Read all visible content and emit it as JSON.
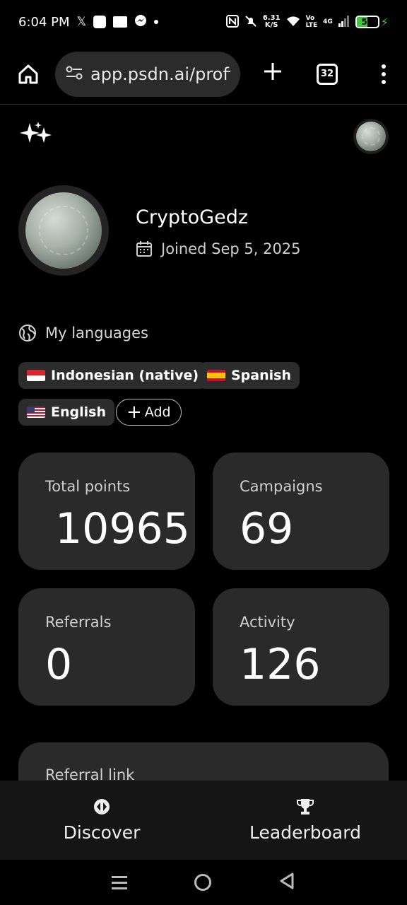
{
  "status_bar": {
    "time": "6:04 PM",
    "network_speed_value": "6.31",
    "network_speed_unit": "K/S",
    "volte": "Vo",
    "lte": "LTE",
    "network_type": "4G",
    "battery": "52",
    "battery_level": 0.52,
    "battery_color": "#3ec93e"
  },
  "browser": {
    "url": "app.psdn.ai/profi",
    "tab_count": "32"
  },
  "profile": {
    "username": "CryptoGedz",
    "joined": "Joined Sep 5, 2025"
  },
  "languages": {
    "title": "My languages",
    "items": [
      {
        "label": "Indonesian (native)",
        "flag": "flag-id"
      },
      {
        "label": "Spanish",
        "flag": "flag-es"
      },
      {
        "label": "English",
        "flag": "flag-us"
      }
    ],
    "add_label": "Add"
  },
  "stats": [
    {
      "label": "Total points",
      "value": "10965"
    },
    {
      "label": "Campaigns",
      "value": "69"
    },
    {
      "label": "Referrals",
      "value": "0"
    },
    {
      "label": "Activity",
      "value": "126"
    }
  ],
  "referral": {
    "label": "Referral link"
  },
  "bottom_nav": {
    "discover": "Discover",
    "leaderboard": "Leaderboard"
  },
  "colors": {
    "background": "#000000",
    "card": "#2a2a2a",
    "nav": "#151515"
  }
}
